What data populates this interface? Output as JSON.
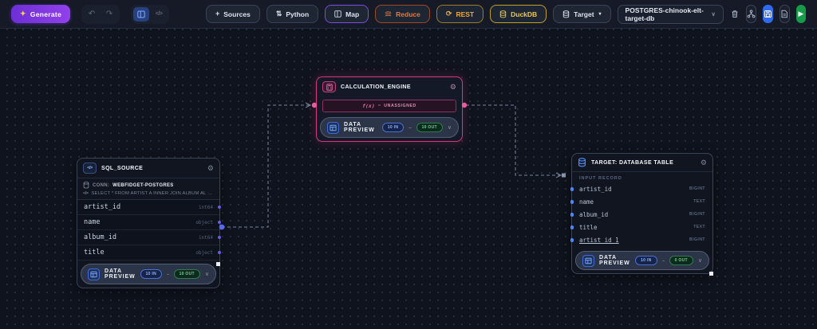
{
  "icons": {
    "sparkle": "✦",
    "undo": "↶",
    "redo": "↷",
    "code": "</>",
    "plus": "+",
    "swap": "⇅",
    "refresh": "⟳",
    "gear": "⚙",
    "chevron_down": "∨",
    "caret_down": "▾",
    "play": "▶"
  },
  "colors": {
    "accent_purple": "#8b5cf6",
    "accent_pink": "#d6387f",
    "accent_blue": "#4f86f7",
    "accent_green": "#179a4a",
    "badge_in": "#93b2ff",
    "badge_out": "#5fd692",
    "canvas_bg": "#0f131d",
    "toolbar_bg": "#151a26"
  },
  "toolbar": {
    "generate_label": "Generate",
    "buttons": [
      {
        "label": "Sources"
      },
      {
        "label": "Python"
      },
      {
        "label": "Map"
      },
      {
        "label": "Reduce"
      },
      {
        "label": "REST"
      },
      {
        "label": "DuckDB"
      },
      {
        "label": "Target",
        "caret": "▾"
      }
    ],
    "pipeline_select": {
      "value": "POSTGRES-chinook-elt-target-db"
    }
  },
  "canvas": {
    "sql_source": {
      "title": "SQL_SOURCE",
      "conn_label": "CONN:",
      "conn_value": "WEBFIDGET-POSTGRES",
      "query": "SELECT * FROM ARTIST A INNER JOIN ALBUM AL ON AL.A...",
      "fields": [
        {
          "name": "artist_id",
          "type": "int64"
        },
        {
          "name": "name",
          "type": "object"
        },
        {
          "name": "album_id",
          "type": "int64"
        },
        {
          "name": "title",
          "type": "object"
        }
      ],
      "preview": {
        "label": "DATA PREVIEW",
        "in": "10 IN",
        "out": "10 OUT"
      }
    },
    "calculation_engine": {
      "title": "CALCULATION_ENGINE",
      "formula_fn": "f(x)",
      "formula_eq": "=",
      "formula_value": "UNASSIGNED",
      "preview": {
        "label": "DATA PREVIEW",
        "in": "10 IN",
        "out": "10 OUT"
      }
    },
    "target": {
      "title": "TARGET: DATABASE TABLE",
      "section_label": "INPUT RECORD",
      "fields": [
        {
          "name": "artist_id",
          "type": "BIGINT"
        },
        {
          "name": "name",
          "type": "TEXT"
        },
        {
          "name": "album_id",
          "type": "BIGINT"
        },
        {
          "name": "title",
          "type": "TEXT"
        },
        {
          "name": "artist_id_1",
          "type": "BIGINT"
        }
      ],
      "preview": {
        "label": "DATA PREVIEW",
        "in": "10 IN",
        "out": "0 OUT"
      }
    }
  }
}
